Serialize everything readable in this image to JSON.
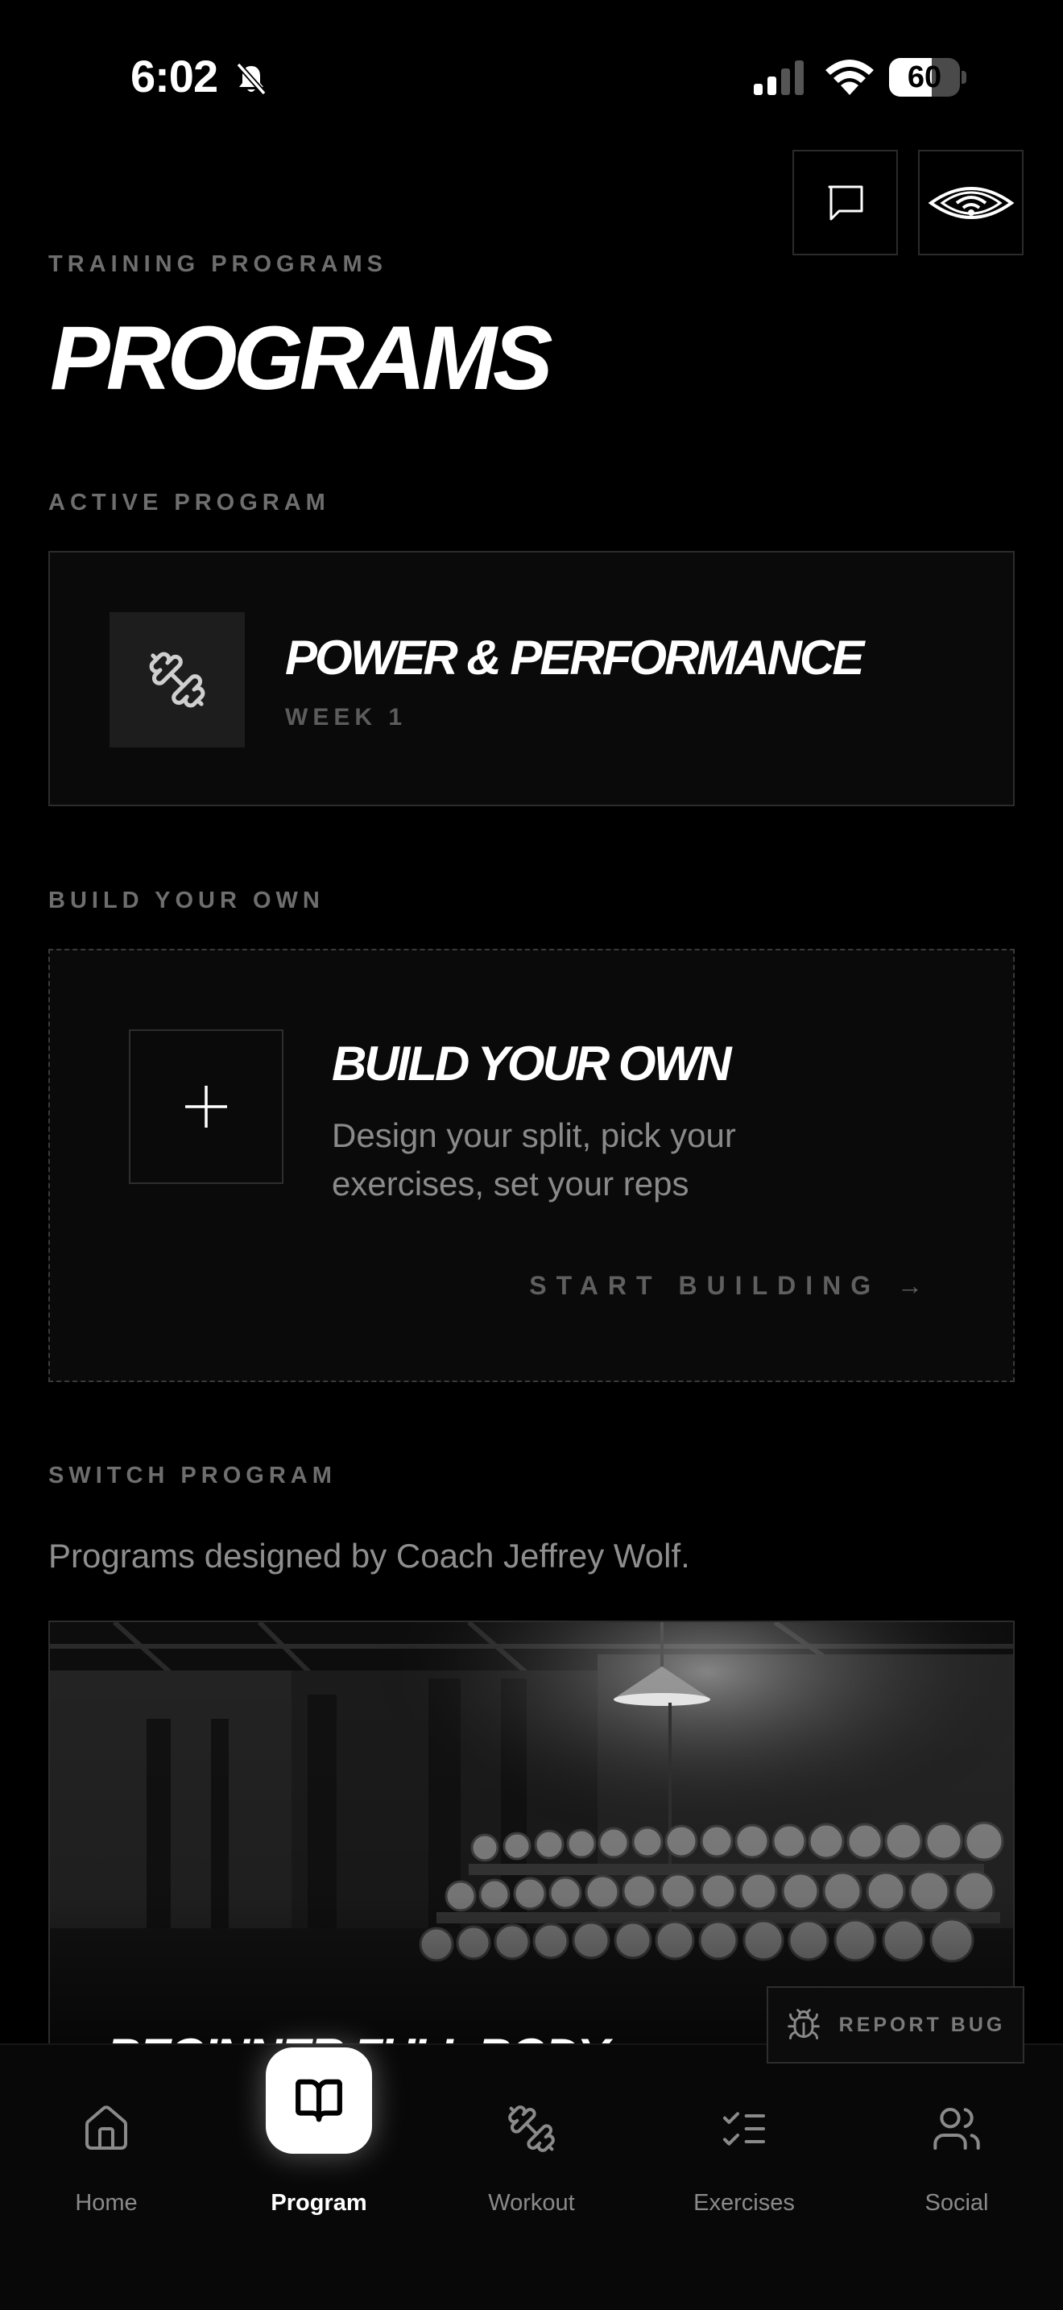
{
  "status_bar": {
    "time": "6:02",
    "battery": "60",
    "battery_level": 0.6
  },
  "header": {
    "eyebrow": "TRAINING PROGRAMS",
    "title": "PROGRAMS"
  },
  "active_section": {
    "label": "ACTIVE PROGRAM",
    "program_name": "POWER & PERFORMANCE",
    "week": "WEEK 1"
  },
  "build_section": {
    "label": "BUILD YOUR OWN",
    "title": "BUILD YOUR OWN",
    "description": "Design your split, pick your exercises, set your reps",
    "cta": "START BUILDING →"
  },
  "switch_section": {
    "label": "SWITCH PROGRAM",
    "description": "Programs designed by Coach Jeffrey Wolf.",
    "programs": [
      {
        "name": "BEGINNER FULL BODY"
      }
    ]
  },
  "report_bug": {
    "label": "REPORT BUG"
  },
  "tabbar": {
    "items": [
      {
        "label": "Home",
        "icon": "home-icon"
      },
      {
        "label": "Program",
        "icon": "book-icon",
        "active": true
      },
      {
        "label": "Workout",
        "icon": "dumbbell-icon"
      },
      {
        "label": "Exercises",
        "icon": "checklist-icon"
      },
      {
        "label": "Social",
        "icon": "users-icon"
      }
    ]
  },
  "colors": {
    "background": "#000000",
    "muted_label": "#6e6e6e",
    "text": "#ffffff"
  }
}
